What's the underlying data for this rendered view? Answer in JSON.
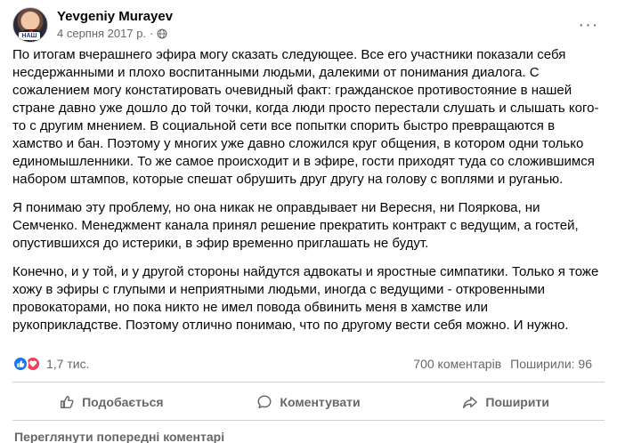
{
  "post": {
    "author": "Yevgeniy Murayev",
    "date": "4 серпня 2017 р.",
    "date_separator": "·",
    "privacy_icon": "globe-icon",
    "more_icon": "more-horizontal-icon",
    "avatar_badge": "НАШ",
    "paragraphs": [
      "По итогам вчерашнего эфира могу сказать следующее. Все его участники показали себя несдержанными и плохо воспитанными людьми, далекими от понимания диалога. С сожалением могу констатировать очевидный факт: гражданское противостояние в нашей стране давно уже дошло до той точки, когда люди просто перестали слушать и слышать кого-то с другим мнением. В социальной сети все попытки спорить быстро превращаются в хамство и бан. Поэтому у многих уже давно сложился круг общения, в котором одни только единомышленники. То же самое происходит и в эфире, гости приходят туда со сложившимся набором штампов, которые спешат обрушить друг другу на голову с воплями и руганью.",
      "Я понимаю эту проблему, но она никак не оправдывает ни Вересня, ни Пояркова, ни Семченко. Менеджмент канала принял решение прекратить контракт с ведущим, а гостей, опустившихся до истерики, в эфир временно приглашать не будут.",
      "Конечно, и у той, и у другой стороны найдутся адвокаты и яростные симпатики. Только я тоже хожу в эфиры с глупыми и неприятными людьми, иногда с ведущими - откровенными провокаторами, но пока никто не имел повода обвинить меня в хамстве или рукоприкладстве. Поэтому отлично понимаю, что по другому вести себя можно. И нужно."
    ]
  },
  "stats": {
    "reaction_icons": [
      "like-icon",
      "love-icon"
    ],
    "reactions_count": "1,7 тис.",
    "comments": "700 коментарів",
    "shares": "Поширили: 96"
  },
  "actions": {
    "like": "Подобається",
    "comment": "Коментувати",
    "share": "Поширити"
  },
  "comments": {
    "previous": "Переглянути попередні коментарі"
  },
  "colors": {
    "like_blue": "#1877f2",
    "love_red": "#f33e58",
    "secondary_text": "#65676b",
    "divider": "#ced0d4"
  }
}
